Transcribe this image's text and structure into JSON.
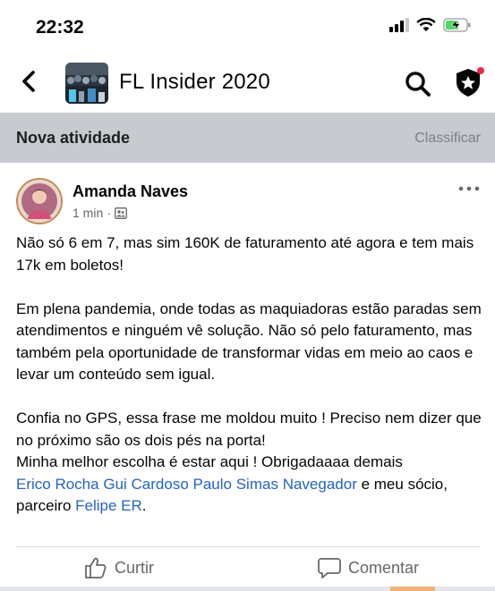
{
  "status_bar": {
    "time": "22:32",
    "icons": [
      "signal-icon",
      "wifi-icon",
      "battery-charging-icon"
    ],
    "battery_color": "#4cd964"
  },
  "header": {
    "back_icon": "chevron-left-icon",
    "group_title": "FL Insider 2020",
    "search_icon": "search-icon",
    "badge_icon": "shield-star-icon",
    "badge_dot_color": "#f02849"
  },
  "activity": {
    "title": "Nova atividade",
    "sort_label": "Classificar"
  },
  "post": {
    "author": "Amanda Naves",
    "time": "1 min",
    "separator": "·",
    "privacy_icon": "group-icon",
    "more_icon": "more-horizontal-icon",
    "paragraph1": "Não só 6 em 7, mas sim 160K de faturamento até agora e tem mais 17k em boletos!",
    "paragraph2": "Em plena pandemia, onde todas as maquiadoras estão paradas sem atendimentos e ninguém vê solução. Não só pelo faturamento, mas também pela oportunidade de transformar vidas em meio ao caos e levar um conteúdo sem igual.",
    "paragraph3_line1": "Confia no GPS, essa frase me moldou muito ! Preciso nem dizer que no próximo são os dois pés na porta!",
    "paragraph3_line2": "Minha melhor escolha é estar aqui ! Obrigadaaaa demais",
    "mentions": [
      "Erico Rocha",
      "Gui Cardoso",
      "Paulo Simas",
      "Navegador"
    ],
    "and_partner": "e meu sócio, parceiro",
    "partner": "Felipe ER",
    "end_punct": ".",
    "link_color": "#2563c7"
  },
  "actions": {
    "like_label": "Curtir",
    "like_icon": "thumbs-up-icon",
    "comment_label": "Comentar",
    "comment_icon": "comment-icon"
  }
}
